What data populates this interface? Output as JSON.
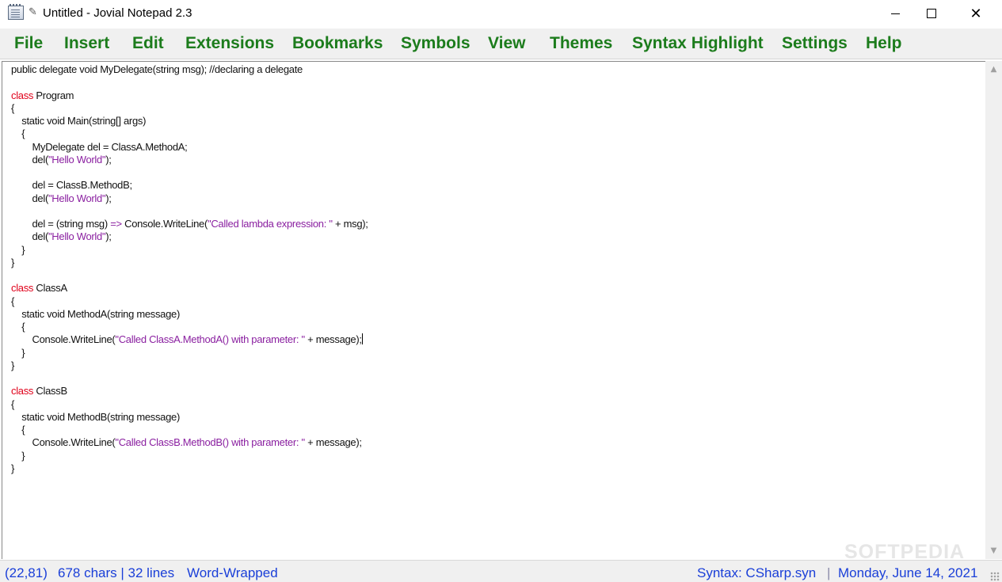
{
  "window": {
    "title": "Untitled - Jovial Notepad 2.3",
    "icons": [
      "notepad-icon",
      "pen-icon"
    ],
    "controls": {
      "minimize": "",
      "maximize": "",
      "close": "✕"
    }
  },
  "menu": [
    "File",
    "Insert",
    "Edit",
    "Extensions",
    "Bookmarks",
    "Symbols",
    "View",
    "Themes",
    "Syntax Highlight",
    "Settings",
    "Help"
  ],
  "colors": {
    "menu_text": "#1c7c1c",
    "keyword": "#e0001a",
    "string": "#8a1fa0",
    "status_text": "#1a3fd8"
  },
  "code": [
    "public delegate void MyDelegate(string msg); //declaring a delegate",
    "",
    "class Program",
    "{",
    "    static void Main(string[] args)",
    "    {",
    "        MyDelegate del = ClassA.MethodA;",
    "        del(\"Hello World\");",
    "",
    "        del = ClassB.MethodB;",
    "        del(\"Hello World\");",
    "",
    "        del = (string msg) => Console.WriteLine(\"Called lambda expression: \" + msg);",
    "        del(\"Hello World\");",
    "    }",
    "}",
    "",
    "class ClassA",
    "{",
    "    static void MethodA(string message)",
    "    {",
    "        Console.WriteLine(\"Called ClassA.MethodA() with parameter: \" + message);",
    "    }",
    "}",
    "",
    "class ClassB",
    "{",
    "    static void MethodB(string message)",
    "    {",
    "        Console.WriteLine(\"Called ClassB.MethodB() with parameter: \" + message);",
    "    }",
    "}"
  ],
  "caret_line": 22,
  "status": {
    "position": "(22,81)",
    "counts": "678 chars | 32 lines",
    "wrap": "Word-Wrapped",
    "syntax": "Syntax: CSharp.syn",
    "separator": "|",
    "date": "Monday, June 14, 2021"
  },
  "watermark": "SOFTPEDIA"
}
